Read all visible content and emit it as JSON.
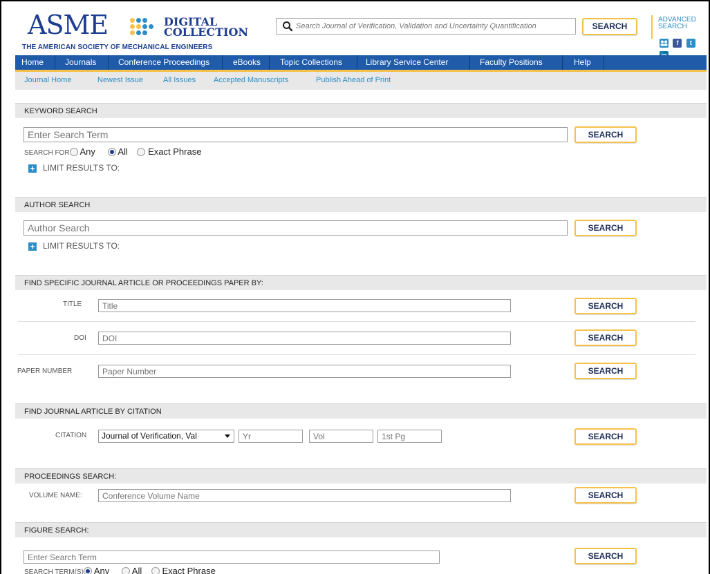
{
  "header": {
    "logo_main": "ASME",
    "logo_digital": "DIGITAL",
    "logo_collection": "COLLECTION",
    "logo_society": "THE AMERICAN SOCIETY OF MECHANICAL ENGINEERS",
    "search_placeholder": "Search Journal of Verification, Validation and Uncertainty Quantification",
    "search_button": "SEARCH",
    "advanced_line1": "ADVANCED",
    "advanced_line2": "SEARCH",
    "social_icons": [
      "people-icon",
      "facebook-icon",
      "twitter-icon",
      "linkedin-icon"
    ],
    "social_facebook": "f",
    "social_twitter": "t",
    "social_linkedin": "in"
  },
  "nav": {
    "items": [
      "Home",
      "Journals",
      "Conference Proceedings",
      "eBooks",
      "Topic Collections",
      "Library Service Center",
      "Faculty Positions",
      "Help"
    ]
  },
  "subnav": {
    "items": [
      "Journal Home",
      "Newest Issue",
      "All Issues",
      "Accepted Manuscripts",
      "Publish Ahead of Print"
    ]
  },
  "keyword_search": {
    "heading": "KEYWORD SEARCH",
    "placeholder": "Enter Search Term",
    "button": "SEARCH",
    "search_for_label": "SEARCH FOR",
    "options": [
      "Any",
      "All",
      "Exact Phrase"
    ],
    "selected": "All",
    "limit": "LIMIT RESULTS TO:"
  },
  "author_search": {
    "heading": "AUTHOR SEARCH",
    "placeholder": "Author Search",
    "button": "SEARCH",
    "limit": "LIMIT RESULTS TO:"
  },
  "find_specific": {
    "heading": "FIND SPECIFIC JOURNAL ARTICLE OR PROCEEDINGS PAPER BY:",
    "title_label": "TITLE",
    "title_placeholder": "Title",
    "doi_label": "DOI",
    "doi_placeholder": "DOI",
    "paper_label": "PAPER NUMBER",
    "paper_placeholder": "Paper Number",
    "button": "SEARCH"
  },
  "citation": {
    "heading": "FIND JOURNAL ARTICLE BY CITATION",
    "label": "CITATION",
    "journal_selected": "Journal of Verification, Val",
    "yr_placeholder": "Yr",
    "vol_placeholder": "Vol",
    "pg_placeholder": "1st Pg",
    "button": "SEARCH"
  },
  "proceedings": {
    "heading": "PROCEEDINGS SEARCH:",
    "label": "VOLUME NAME:",
    "placeholder": "Conference Volume Name",
    "button": "SEARCH"
  },
  "figure": {
    "heading": "FIGURE SEARCH:",
    "placeholder": "Enter Search Term",
    "button": "SEARCH",
    "terms_label": "SEARCH TERM(S)",
    "options": [
      "Any",
      "All",
      "Exact Phrase"
    ],
    "selected": "Any"
  },
  "colors": {
    "nav_bg": "#1f5ba9",
    "accent_gold": "#f6c14a",
    "link_blue": "#2c8ec7",
    "brand_navy": "#1d3d8f"
  }
}
